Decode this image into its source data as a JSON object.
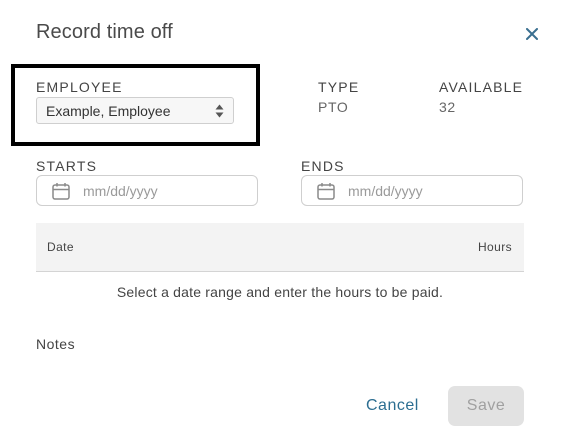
{
  "dialog": {
    "title": "Record time off",
    "close_icon": "close-icon"
  },
  "employee": {
    "label": "EMPLOYEE",
    "selected": "Example, Employee"
  },
  "type": {
    "label": "TYPE",
    "value": "PTO"
  },
  "available": {
    "label": "AVAILABLE",
    "value": "32"
  },
  "starts": {
    "label": "STARTS",
    "placeholder": "mm/dd/yyyy",
    "icon": "calendar-icon"
  },
  "ends": {
    "label": "ENDS",
    "placeholder": "mm/dd/yyyy",
    "icon": "calendar-icon"
  },
  "table": {
    "columns": [
      "Date",
      "Hours"
    ],
    "empty_message": "Select a date range and enter the hours to be paid."
  },
  "notes": {
    "label": "Notes"
  },
  "actions": {
    "cancel_label": "Cancel",
    "save_label": "Save"
  },
  "colors": {
    "link": "#2c6e91",
    "disabled_bg": "#e2e2e2",
    "disabled_text": "#a0a0a0",
    "highlight_border": "#000000"
  }
}
